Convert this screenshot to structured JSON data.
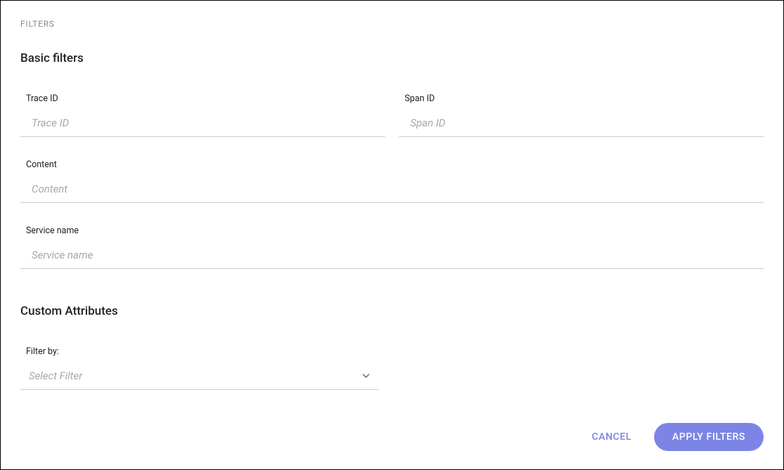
{
  "header": {
    "eyebrow": "FILTERS"
  },
  "basic": {
    "title": "Basic filters",
    "trace_id": {
      "label": "Trace ID",
      "placeholder": "Trace ID",
      "value": ""
    },
    "span_id": {
      "label": "Span ID",
      "placeholder": "Span ID",
      "value": ""
    },
    "content": {
      "label": "Content",
      "placeholder": "Content",
      "value": ""
    },
    "service_name": {
      "label": "Service name",
      "placeholder": "Service name",
      "value": ""
    }
  },
  "custom": {
    "title": "Custom Attributes",
    "filter_by": {
      "label": "Filter by:",
      "placeholder": "Select Filter",
      "selected": ""
    }
  },
  "actions": {
    "cancel": "CANCEL",
    "apply": "APPLY FILTERS"
  },
  "icons": {
    "chevron_down": "chevron-down-icon"
  },
  "colors": {
    "accent": "#7c85e6",
    "text_muted": "#888a8c",
    "border_input": "#c9cacc",
    "placeholder": "#a5a7aa"
  }
}
